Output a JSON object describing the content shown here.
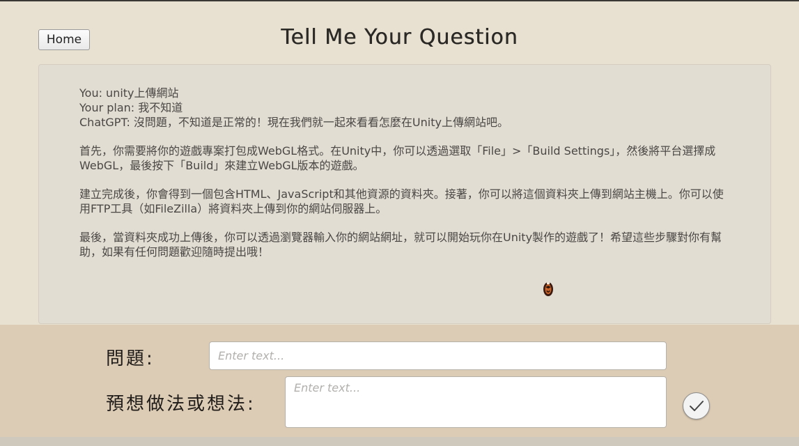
{
  "header": {
    "home_label": "Home",
    "title": "Tell Me Your Question"
  },
  "chat": {
    "lines": [
      "You: unity上傳網站",
      "Your plan: 我不知道",
      "ChatGPT: 沒問題，不知道是正常的！現在我們就一起來看看怎麼在Unity上傳網站吧。",
      "首先，你需要將你的遊戲專案打包成WebGL格式。在Unity中，你可以透過選取「File」>「Build Settings」，然後將平台選擇成WebGL，最後按下「Build」來建立WebGL版本的遊戲。",
      "建立完成後，你會得到一個包含HTML、JavaScript和其他資源的資料夾。接著，你可以將這個資料夾上傳到網站主機上。你可以使用FTP工具（如FileZilla）將資料夾上傳到你的網站伺服器上。",
      "最後，當資料夾成功上傳後，你可以透過瀏覽器輸入你的網站網址，就可以開始玩你在Unity製作的遊戲了！希望這些步驟對你有幫助，如果有任何問題歡迎隨時提出哦！"
    ]
  },
  "form": {
    "question_label": "問題:",
    "question_placeholder": "Enter text...",
    "plan_label": "預想做法或想法:",
    "plan_placeholder": "Enter text...",
    "submit_icon": "checkmark-icon"
  },
  "colors": {
    "background": "#e8e0d1",
    "panel": "#e2ddd3",
    "bottom_bar": "#ddccb5"
  }
}
